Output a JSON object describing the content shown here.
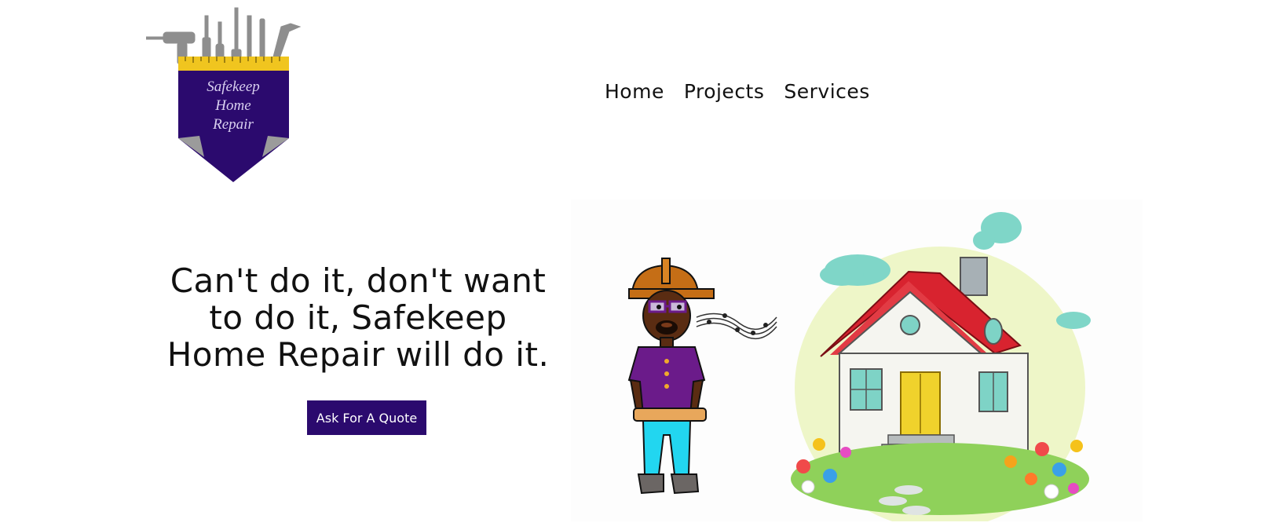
{
  "logo": {
    "line1": "Safekeep",
    "line2": "Home",
    "line3": "Repair"
  },
  "nav": {
    "items": [
      {
        "label": "Home"
      },
      {
        "label": "Projects"
      },
      {
        "label": "Services"
      }
    ]
  },
  "hero": {
    "headline": "Can't do it, don't want to do it, Safekeep Home Repair will do it.",
    "cta_label": "Ask For A Quote"
  },
  "colors": {
    "brand_purple": "#2b0a6e",
    "ruler_yellow": "#f0c51f",
    "tool_gray": "#8e8e8e",
    "roof_red": "#d8232f"
  },
  "icons": {
    "logo": "tool-belt-pocket-logo",
    "illustration": "handyman-and-house-illustration"
  }
}
